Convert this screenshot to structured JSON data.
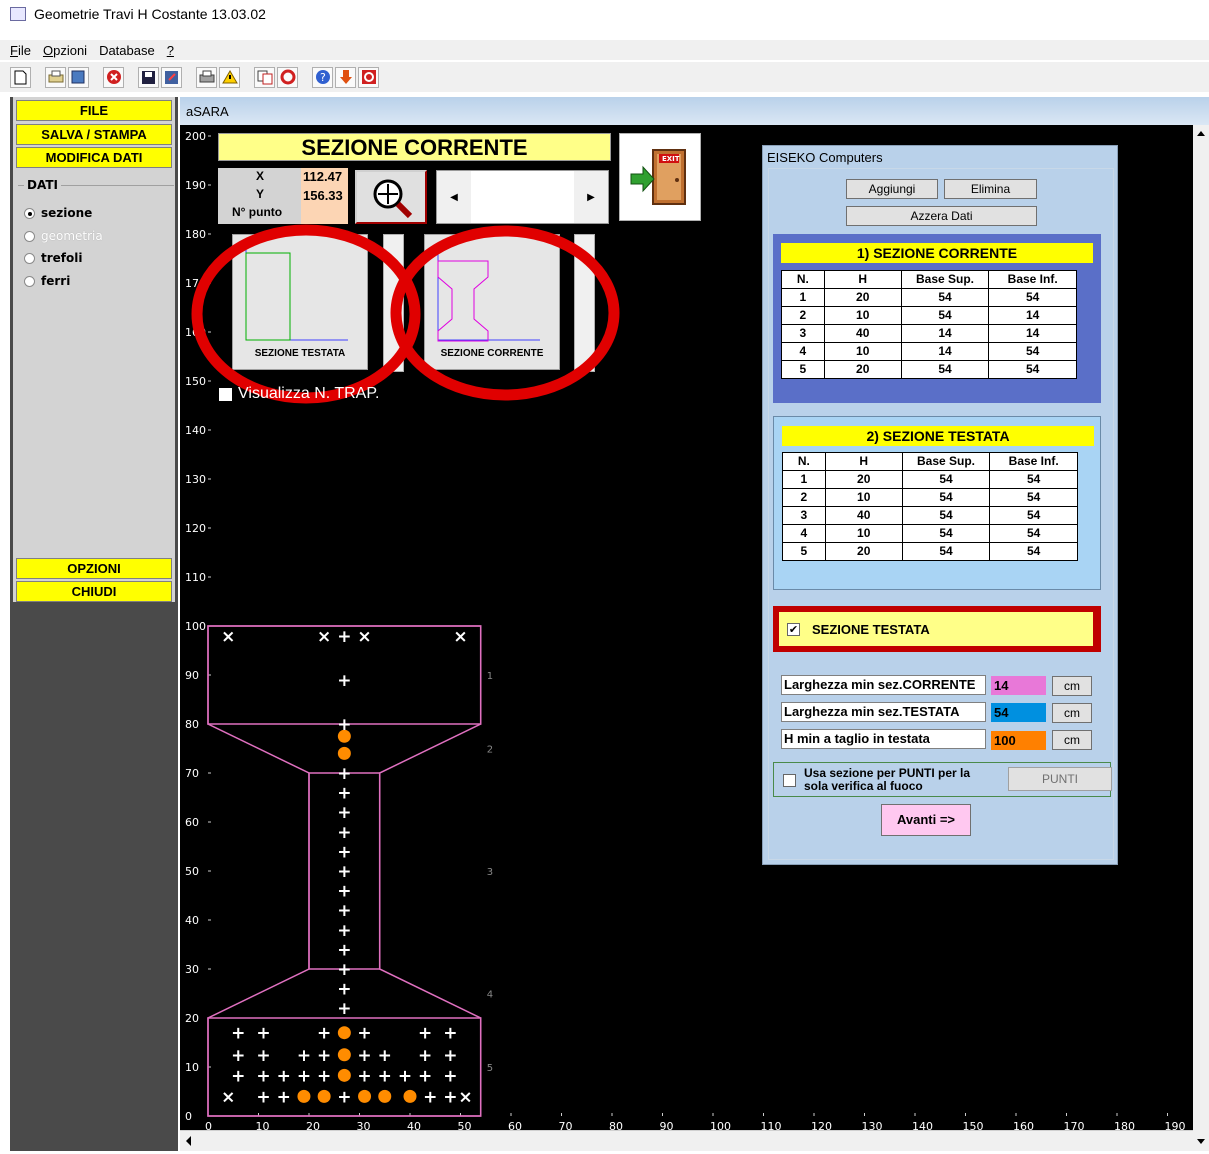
{
  "window": {
    "title": "Geometrie Travi H Costante  13.03.02"
  },
  "menu": [
    {
      "label": "File",
      "accel": "F",
      "rest": "ile"
    },
    {
      "label": "Opzioni",
      "accel": "O",
      "rest": "pzioni"
    },
    {
      "label": "Database",
      "accel": "",
      "rest": "Database"
    },
    {
      "label": "?",
      "accel": "?",
      "rest": ""
    }
  ],
  "toolbar": {
    "icons": [
      "new-file-icon",
      "print-icon",
      "print-preview-icon",
      "close-icon",
      "save-icon",
      "export-icon",
      "printer-icon",
      "warning-icon",
      "copy-icon",
      "refresh-icon",
      "help-icon",
      "down-arrow-icon",
      "info-icon"
    ]
  },
  "sidebar": {
    "file": "FILE",
    "salva": "SALVA / STAMPA",
    "modifica": "MODIFICA DATI",
    "group_label": "DATI",
    "radios": [
      {
        "label": "sezione",
        "checked": true,
        "enabled": true
      },
      {
        "label": "geometria",
        "checked": false,
        "enabled": false
      },
      {
        "label": "trefoli",
        "checked": false,
        "enabled": true
      },
      {
        "label": "ferri",
        "checked": false,
        "enabled": true
      }
    ],
    "opzioni": "OPZIONI",
    "chiudi": "CHIUDI"
  },
  "child_window": {
    "title": "aSARA"
  },
  "overlay": {
    "banner": "SEZIONE  CORRENTE",
    "x_label": "X",
    "y_label": "Y",
    "punto_label": "N° punto",
    "x_value": "112.47",
    "y_value": "156.33",
    "thumb_testata": "SEZIONE TESTATA",
    "thumb_corrente": "SEZIONE CORRENTE",
    "visualizza": "Visualizza N. TRAP."
  },
  "dialog": {
    "title": "EISEKO Computers",
    "aggiungi": "Aggiungi",
    "elimina": "Elimina",
    "azzera": "Azzera Dati",
    "table_headers": [
      "N.",
      "H",
      "Base Sup.",
      "Base Inf."
    ],
    "corrente": {
      "title": "1) SEZIONE CORRENTE",
      "rows": [
        [
          "1",
          "20",
          "54",
          "54"
        ],
        [
          "2",
          "10",
          "54",
          "14"
        ],
        [
          "3",
          "40",
          "14",
          "14"
        ],
        [
          "4",
          "10",
          "14",
          "54"
        ],
        [
          "5",
          "20",
          "54",
          "54"
        ]
      ]
    },
    "testata": {
      "title": "2) SEZIONE TESTATA",
      "rows": [
        [
          "1",
          "20",
          "54",
          "54"
        ],
        [
          "2",
          "10",
          "54",
          "54"
        ],
        [
          "3",
          "40",
          "54",
          "54"
        ],
        [
          "4",
          "10",
          "54",
          "54"
        ],
        [
          "5",
          "20",
          "54",
          "54"
        ]
      ]
    },
    "sezione_testata_check": "SEZIONE TESTATA",
    "sezione_testata_checked": true,
    "fields": [
      {
        "label": "Larghezza min sez.CORRENTE",
        "value": "14",
        "color": "#e878d8",
        "unit": "cm"
      },
      {
        "label": "Larghezza min sez.TESTATA",
        "value": "54",
        "color": "#0090e0",
        "unit": "cm"
      },
      {
        "label": "H min a taglio in testata",
        "value": "100",
        "color": "#ff8000",
        "unit": "cm"
      }
    ],
    "punti_label_1": "Usa sezione per PUNTI per la",
    "punti_label_2": "sola verifica al fuoco",
    "punti_button": "PUNTI",
    "avanti": "Avanti =>"
  },
  "chart_data": {
    "type": "scatter",
    "x_ticks": [
      0,
      10,
      20,
      30,
      40,
      50,
      60,
      70,
      80,
      90,
      100,
      110,
      120,
      130,
      140,
      150,
      160,
      170,
      180,
      190
    ],
    "y_ticks": [
      0,
      10,
      20,
      30,
      40,
      50,
      60,
      70,
      80,
      90,
      100,
      110,
      120,
      130,
      140,
      150,
      160,
      170,
      180,
      190,
      200
    ],
    "xlim": [
      0,
      194
    ],
    "ylim": [
      0,
      202
    ],
    "section_outline": [
      [
        0,
        0
      ],
      [
        54,
        0
      ],
      [
        54,
        20
      ],
      [
        34,
        30
      ],
      [
        34,
        70
      ],
      [
        54,
        80
      ],
      [
        54,
        100
      ],
      [
        0,
        100
      ],
      [
        0,
        80
      ],
      [
        20,
        70
      ],
      [
        20,
        30
      ],
      [
        0,
        20
      ]
    ],
    "trapezoid_lines": [
      20,
      30,
      70,
      80
    ],
    "trapezoid_numbers": [
      {
        "label": "1",
        "y": 90
      },
      {
        "label": "2",
        "y": 75
      },
      {
        "label": "3",
        "y": 50
      },
      {
        "label": "4",
        "y": 25
      },
      {
        "label": "5",
        "y": 10
      }
    ],
    "plus_points": [
      [
        27,
        98
      ],
      [
        27,
        89
      ],
      [
        27,
        80
      ],
      [
        27,
        70
      ],
      [
        27,
        66
      ],
      [
        27,
        62
      ],
      [
        27,
        58
      ],
      [
        27,
        54
      ],
      [
        27,
        50
      ],
      [
        27,
        46
      ],
      [
        27,
        42
      ],
      [
        27,
        38
      ],
      [
        27,
        34
      ],
      [
        27,
        30
      ],
      [
        27,
        26
      ],
      [
        27,
        22
      ],
      [
        6,
        17
      ],
      [
        11,
        17
      ],
      [
        23,
        17
      ],
      [
        31,
        17
      ],
      [
        43,
        17
      ],
      [
        48,
        17
      ],
      [
        6,
        12.5
      ],
      [
        11,
        12.5
      ],
      [
        19,
        12.5
      ],
      [
        23,
        12.5
      ],
      [
        31,
        12.5
      ],
      [
        35,
        12.5
      ],
      [
        43,
        12.5
      ],
      [
        48,
        12.5
      ],
      [
        6,
        8.3
      ],
      [
        11,
        8.3
      ],
      [
        15,
        8.3
      ],
      [
        19,
        8.3
      ],
      [
        23,
        8.3
      ],
      [
        31,
        8.3
      ],
      [
        35,
        8.3
      ],
      [
        39,
        8.3
      ],
      [
        43,
        8.3
      ],
      [
        48,
        8.3
      ],
      [
        11,
        4
      ],
      [
        15,
        4
      ],
      [
        27,
        4
      ],
      [
        44,
        4
      ],
      [
        48,
        4
      ]
    ],
    "cross_points": [
      [
        4,
        98
      ],
      [
        23,
        98
      ],
      [
        31,
        98
      ],
      [
        50,
        98
      ],
      [
        4,
        4
      ],
      [
        51,
        4
      ]
    ],
    "strand_points": [
      [
        27,
        77.5
      ],
      [
        27,
        74
      ],
      [
        27,
        17
      ],
      [
        27,
        12.5
      ],
      [
        27,
        8.3
      ],
      [
        19,
        4
      ],
      [
        23,
        4
      ],
      [
        31,
        4
      ],
      [
        35,
        4
      ],
      [
        40,
        4
      ]
    ]
  }
}
